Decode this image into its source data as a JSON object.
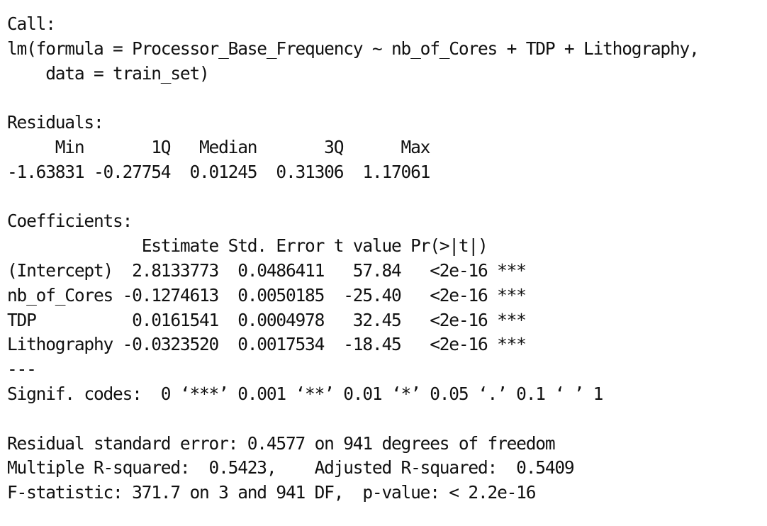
{
  "output": {
    "lines": [
      "Call:",
      "lm(formula = Processor_Base_Frequency ~ nb_of_Cores + TDP + Lithography,",
      "    data = train_set)",
      "",
      "Residuals:",
      "     Min       1Q   Median       3Q      Max ",
      "-1.63831 -0.27754  0.01245  0.31306  1.17061 ",
      "",
      "Coefficients:",
      "              Estimate Std. Error t value Pr(>|t|)    ",
      "(Intercept)  2.8133773  0.0486411   57.84   <2e-16 ***",
      "nb_of_Cores -0.1274613  0.0050185  -25.40   <2e-16 ***",
      "TDP          0.0161541  0.0004978   32.45   <2e-16 ***",
      "Lithography -0.0323520  0.0017534  -18.45   <2e-16 ***",
      "---",
      "Signif. codes:  0 ‘***’ 0.001 ‘**’ 0.01 ‘*’ 0.05 ‘.’ 0.1 ‘ ’ 1",
      "",
      "Residual standard error: 0.4577 on 941 degrees of freedom",
      "Multiple R-squared:  0.5423,\tAdjusted R-squared:  0.5409 ",
      "F-statistic: 371.7 on 3 and 941 DF,  p-value: < 2.2e-16"
    ]
  }
}
